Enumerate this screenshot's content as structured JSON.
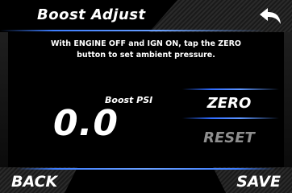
{
  "header": {
    "title": "Boost Adjust",
    "back_icon": "undo-arrow-icon"
  },
  "instructions": {
    "line1": "With ENGINE OFF and IGN ON, tap the ZERO",
    "line2": "button to set ambient pressure."
  },
  "reading": {
    "label": "Boost PSI",
    "value": "0.0"
  },
  "buttons": {
    "zero": "ZERO",
    "reset": "RESET",
    "back": "BACK",
    "save": "SAVE"
  },
  "colors": {
    "accent": "#3d7dff",
    "disabled_text": "#8e8e8e",
    "background": "#000000"
  }
}
